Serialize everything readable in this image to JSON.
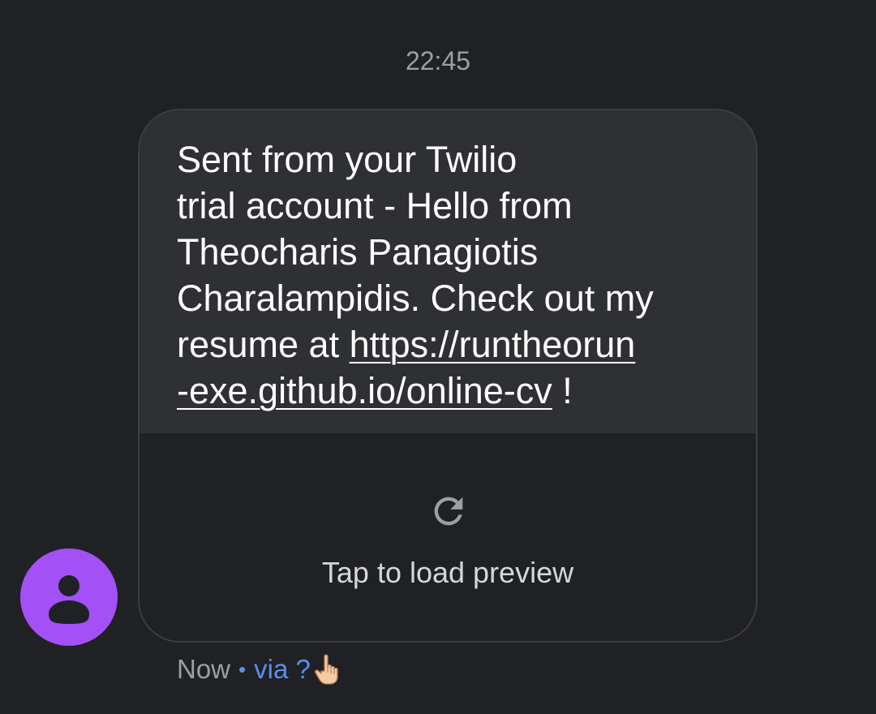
{
  "conversation": {
    "timestamp": "22:45"
  },
  "message": {
    "lines": [
      "Sent from your Twilio",
      "trial account - Hello from",
      "Theocharis Panagiotis",
      "Charalampidis. Check out my"
    ],
    "line5_prefix": "resume at ",
    "link_part1": "https://runtheorun",
    "link_part2": "-exe.github.io/online-cv",
    "line6_suffix": " !",
    "preview_label": "Tap to load preview",
    "preview_icon": "refresh-icon"
  },
  "sender": {
    "avatar_icon": "person-icon",
    "avatar_color": "#a350f6"
  },
  "footer": {
    "time": "Now",
    "separator": "•",
    "via": "via ?",
    "hand_icon": "pointing-hand-icon"
  },
  "colors": {
    "background": "#202124",
    "bubble": "#2f3033",
    "link_accent": "#5b8def"
  }
}
